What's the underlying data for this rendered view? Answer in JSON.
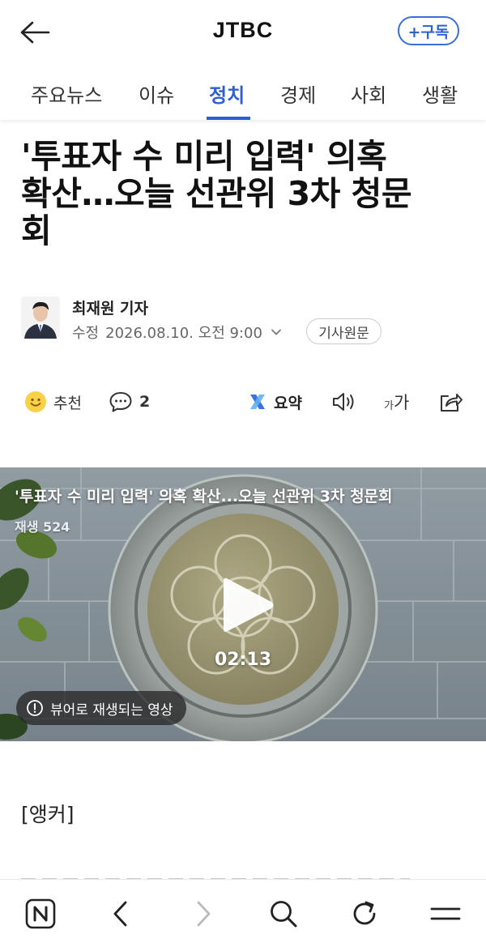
{
  "header": {
    "brand": "JTBC",
    "subscribe_label": "+구독"
  },
  "tabs": [
    {
      "label": "주요뉴스",
      "active": false
    },
    {
      "label": "이슈",
      "active": false
    },
    {
      "label": "정치",
      "active": true
    },
    {
      "label": "경제",
      "active": false
    },
    {
      "label": "사회",
      "active": false
    },
    {
      "label": "생활",
      "active": false
    }
  ],
  "article": {
    "headline_lines": [
      "'투표자 수 미리 입력' 의혹",
      "확산…오늘 선관위 3차 청문",
      "회"
    ],
    "author": "최재원 기자",
    "modified_label": "수정",
    "datetime": "2026.08.10. 오전 9:00",
    "source_button": "기사원문",
    "body_start": "[앵커]"
  },
  "actions": {
    "like_label": "추천",
    "comment_count": "2",
    "summary_label": "요약",
    "font_size_small": "가",
    "font_size_large": "가"
  },
  "video": {
    "title": "'투표자 수 미리 입력' 의혹 확산...오늘 선관위 3차 청문회",
    "views": "재생 524",
    "duration": "02:13",
    "notice": "뷰어로 재생되는 영상"
  },
  "icons": {
    "back": "arrow-left-icon",
    "like": "smiley-icon",
    "comment": "speech-bubble-icon",
    "summary": "ai-summary-icon",
    "speaker": "speaker-icon",
    "share": "share-icon",
    "home": "naver-n-icon",
    "prev": "chevron-left-icon",
    "next": "chevron-right-icon",
    "search": "search-icon",
    "refresh": "refresh-icon",
    "menu": "menu-icon"
  },
  "colors": {
    "accent": "#2d5fd2",
    "subscribe": "#3a6fd8",
    "summary_icon": "#3d6fe0"
  }
}
